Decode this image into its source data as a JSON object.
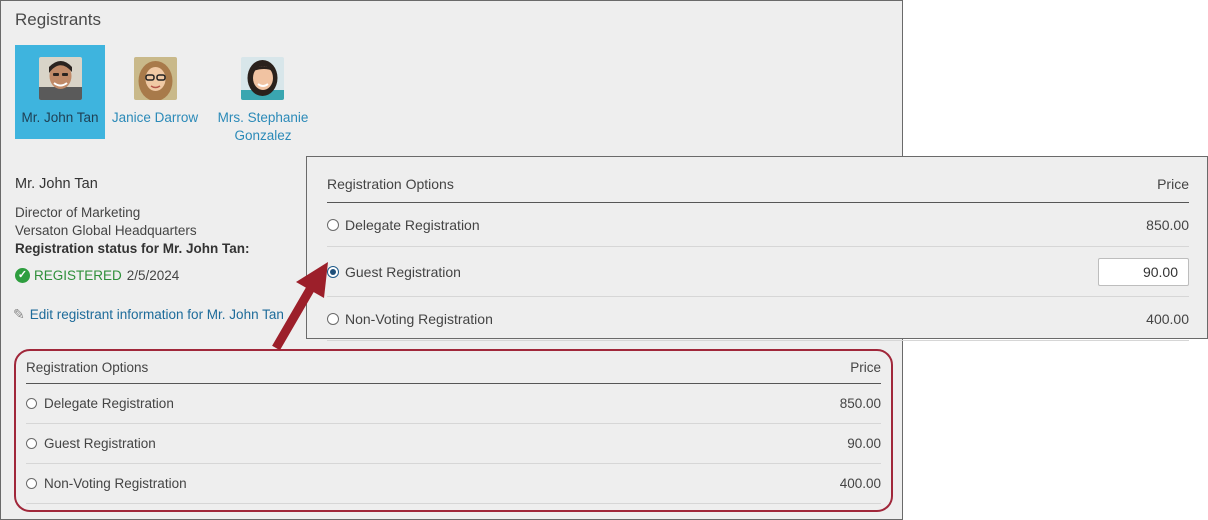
{
  "panel": {
    "title": "Registrants"
  },
  "registrants": [
    {
      "name": "Mr. John Tan",
      "selected": true
    },
    {
      "name": "Janice Darrow",
      "selected": false
    },
    {
      "name_line1": "Mrs. Stephanie",
      "name_line2": "Gonzalez",
      "selected": false
    }
  ],
  "detail": {
    "name": "Mr. John Tan",
    "title": "Director of Marketing",
    "company": "Versaton Global Headquarters",
    "status_label": "Registration status for Mr. John Tan:",
    "status": "REGISTERED",
    "status_date": "2/5/2024",
    "edit_link": "Edit registrant information for Mr. John Tan"
  },
  "options": {
    "header": "Registration Options",
    "price_header": "Price",
    "rows": [
      {
        "label": "Delegate Registration",
        "price": "850.00"
      },
      {
        "label": "Guest Registration",
        "price": "90.00"
      },
      {
        "label": "Non-Voting Registration",
        "price": "400.00"
      }
    ]
  },
  "zoom": {
    "header": "Registration Options",
    "price_header": "Price",
    "selected_index": 1,
    "rows": [
      {
        "label": "Delegate Registration",
        "price": "850.00"
      },
      {
        "label": "Guest Registration",
        "price": "90.00"
      },
      {
        "label": "Non-Voting Registration",
        "price": "400.00"
      }
    ]
  },
  "colors": {
    "selected_card": "#3eb4de",
    "highlight_outline": "#a0273a",
    "link": "#1d6b9a",
    "registered_green": "#2e9e3f"
  },
  "icons": {
    "status": "check-circle-icon",
    "edit": "pencil-icon",
    "callout": "arrow-icon"
  }
}
